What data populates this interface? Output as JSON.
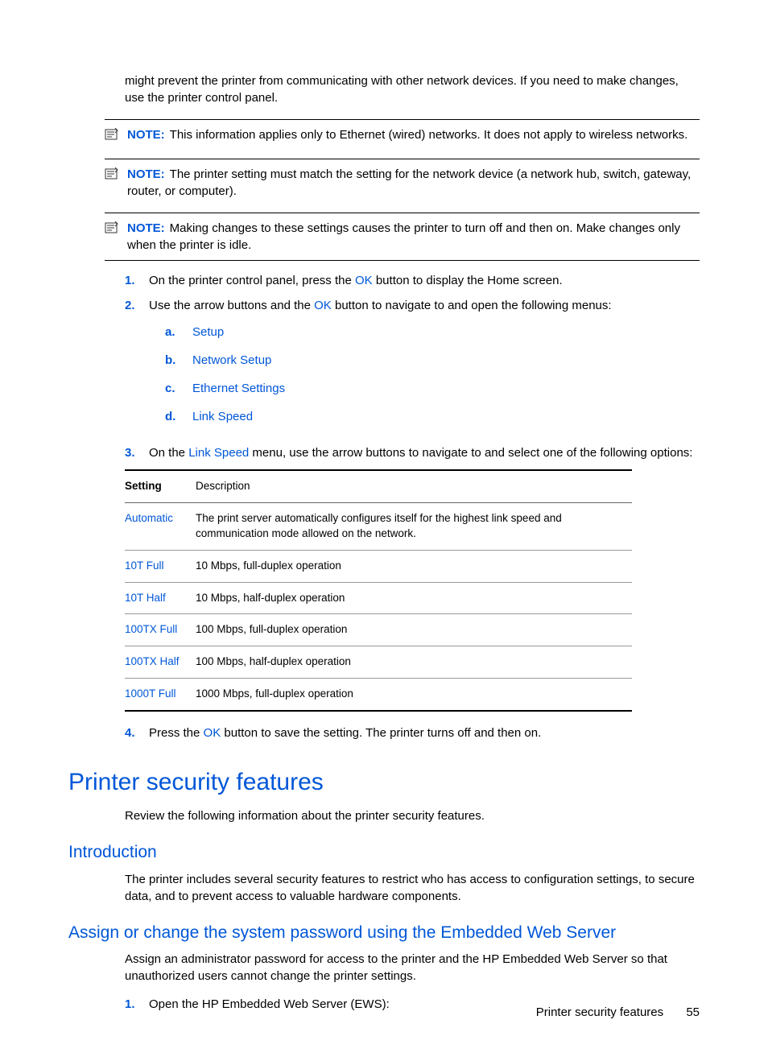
{
  "intro_para": "might prevent the printer from communicating with other network devices. If you need to make changes, use the printer control panel.",
  "notes": [
    {
      "label": "NOTE:",
      "text": "This information applies only to Ethernet (wired) networks. It does not apply to wireless networks."
    },
    {
      "label": "NOTE:",
      "text": "The printer setting must match the setting for the network device (a network hub, switch, gateway, router, or computer)."
    },
    {
      "label": "NOTE:",
      "text": "Making changes to these settings causes the printer to turn off and then on. Make changes only when the printer is idle."
    }
  ],
  "steps": {
    "s1": {
      "n": "1.",
      "pre": "On the printer control panel, press the ",
      "link": "OK",
      "post": " button to display the Home screen."
    },
    "s2": {
      "n": "2.",
      "pre": "Use the arrow buttons and the ",
      "link": "OK",
      "post": " button to navigate to and open the following menus:"
    },
    "sub": [
      {
        "n": "a.",
        "label": "Setup"
      },
      {
        "n": "b.",
        "label": "Network Setup"
      },
      {
        "n": "c.",
        "label": "Ethernet Settings"
      },
      {
        "n": "d.",
        "label": "Link Speed"
      }
    ],
    "s3": {
      "n": "3.",
      "pre": "On the ",
      "link": "Link Speed",
      "post": " menu, use the arrow buttons to navigate to and select one of the following options:"
    },
    "s4": {
      "n": "4.",
      "pre": "Press the ",
      "link": "OK",
      "post": " button to save the setting. The printer turns off and then on."
    }
  },
  "table": {
    "h1": "Setting",
    "h2": "Description",
    "rows": [
      {
        "s": "Automatic",
        "d": "The print server automatically configures itself for the highest link speed and communication mode allowed on the network."
      },
      {
        "s": "10T Full",
        "d": "10 Mbps, full-duplex operation"
      },
      {
        "s": "10T Half",
        "d": "10 Mbps, half-duplex operation"
      },
      {
        "s": "100TX Full",
        "d": "100 Mbps, full-duplex operation"
      },
      {
        "s": "100TX Half",
        "d": "100 Mbps, half-duplex operation"
      },
      {
        "s": "1000T Full",
        "d": "1000 Mbps, full-duplex operation"
      }
    ]
  },
  "heading1": "Printer security features",
  "h1_para": "Review the following information about the printer security features.",
  "heading2a": "Introduction",
  "h2a_para": "The printer includes several security features to restrict who has access to configuration settings, to secure data, and to prevent access to valuable hardware components.",
  "heading2b": "Assign or change the system password using the Embedded Web Server",
  "h2b_para": "Assign an administrator password for access to the printer and the HP Embedded Web Server so that unauthorized users cannot change the printer settings.",
  "step_ews": {
    "n": "1.",
    "text": "Open the HP Embedded Web Server (EWS):"
  },
  "footer": {
    "title": "Printer security features",
    "page": "55"
  }
}
